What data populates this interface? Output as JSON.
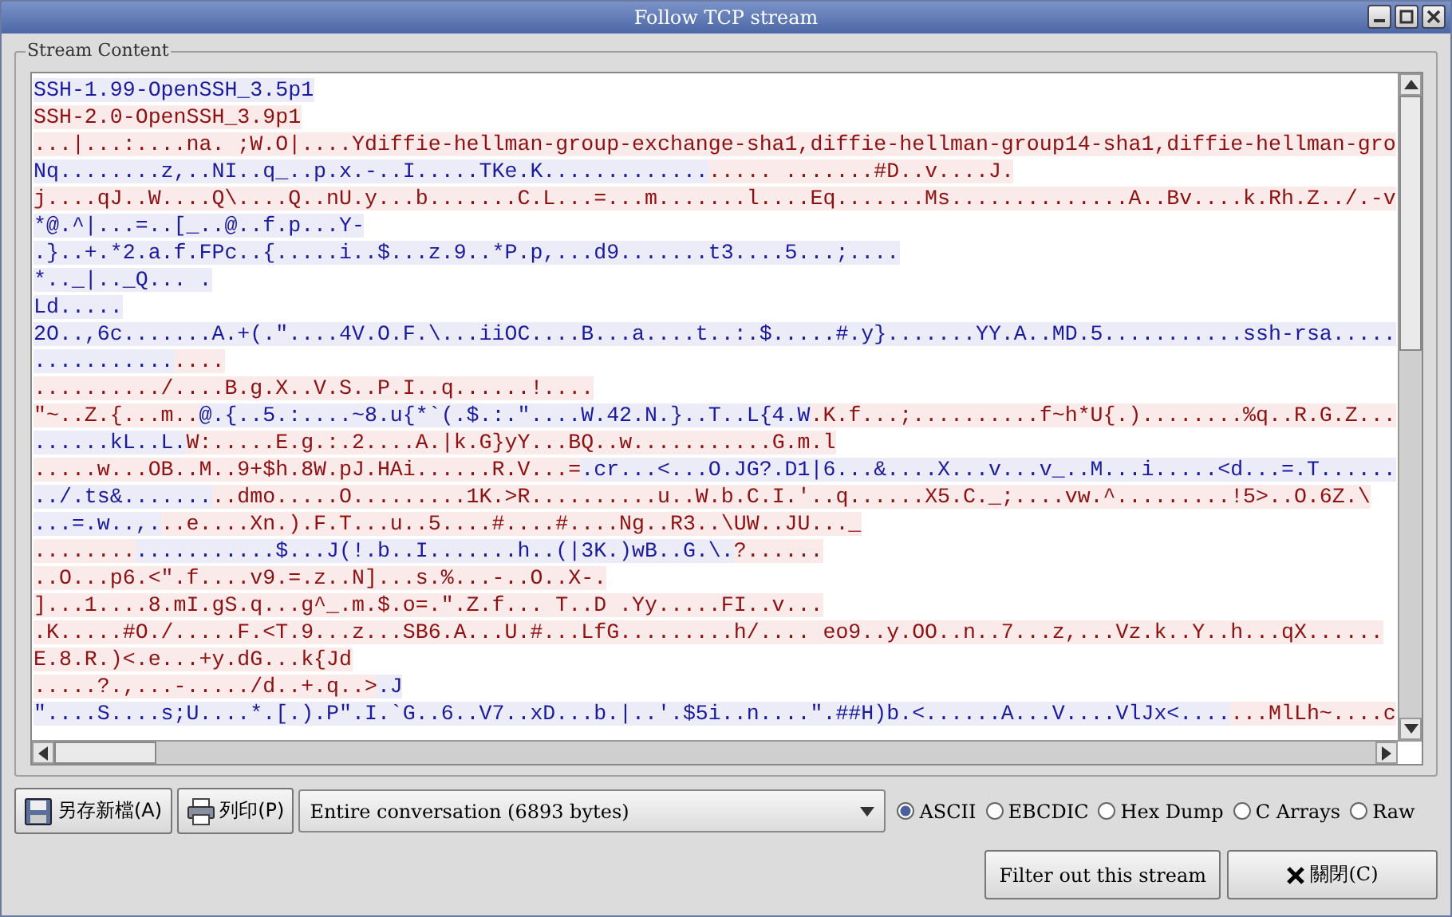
{
  "window": {
    "title": "Follow TCP stream"
  },
  "frame": {
    "label": "Stream Content"
  },
  "lines": [
    [
      {
        "kind": "client",
        "text": "SSH-1.99-OpenSSH_3.5p1"
      }
    ],
    [
      {
        "kind": "server",
        "text": "SSH-2.0-OpenSSH_3.9p1"
      }
    ],
    [
      {
        "kind": "server",
        "text": "...|...:....na. ;W.O|....Ydiffie-hellman-group-exchange-sha1,diffie-hellman-group14-sha1,diffie-hellman-gro"
      }
    ],
    [
      {
        "kind": "client",
        "text": "Nq........z,..NI..q_..p.x.-..I.....TKe.K............."
      },
      {
        "kind": "server",
        "text": "..... .......#D..v....J."
      }
    ],
    [
      {
        "kind": "server",
        "text": "j....qJ..W....Q\\....Q..nU.y...b.......C.L...=...m.......l....Eq.......Ms..............A..Bv....k.Rh.Z../.-v"
      }
    ],
    [
      {
        "kind": "client",
        "text": "*@.^|...=..[_..@..f.p...Y-"
      }
    ],
    [
      {
        "kind": "client",
        "text": ".}..+.*2.a.f.FPc..{.....i..$...z.9..*P.p,...d9.......t3....5...;...."
      }
    ],
    [
      {
        "kind": "client",
        "text": "*.._|.._Q... ."
      }
    ],
    [
      {
        "kind": "client",
        "text": "Ld....."
      }
    ],
    [
      {
        "kind": "client",
        "text": "2O..,6c.......A.+(.\"....4V.O.F.\\...iiOC....B...a....t..:.$.....#.y}.......YY.A..MD.5...........ssh-rsa....."
      }
    ],
    [
      {
        "kind": "client",
        "text": "..........."
      },
      {
        "kind": "server",
        "text": "...."
      }
    ],
    [
      {
        "kind": "server",
        "text": "........../....B.g.X..V.S..P.I..q......!...."
      }
    ],
    [
      {
        "kind": "server",
        "text": "\"~..Z.{...m.."
      },
      {
        "kind": "client",
        "text": "@.{..5.:....~8.u{*`(.$.:.\"....W.42.N.}..T..L{4.W"
      },
      {
        "kind": "server",
        "text": ".K.f...;..........f~h*U{.)........%q..R.G.Z..."
      }
    ],
    [
      {
        "kind": "client",
        "text": "......kL..L."
      },
      {
        "kind": "server",
        "text": "W:.....E.g.:.2....A.|k.G}yY...BQ..w...........G.m.l"
      }
    ],
    [
      {
        "kind": "server",
        "text": ".....w...OB..M..9+$h.8W.pJ.HAi......R.V...="
      },
      {
        "kind": "client",
        "text": ".cr...<...O.JG?.D1|6...&....X...v...v_..M...i.....<d...=.T......"
      }
    ],
    [
      {
        "kind": "client",
        "text": "../.ts&......."
      },
      {
        "kind": "server",
        "text": "..dmo.....O.........1K.>R..........u..W.b.C.I.'..q......X5.C._;....vw.^.........!5>..O.6Z.\\"
      }
    ],
    [
      {
        "kind": "client",
        "text": "...=.w..,."
      },
      {
        "kind": "server",
        "text": "..e....Xn.).F.T...u..5....#....#....Ng..R3..\\UW..JU..._"
      }
    ],
    [
      {
        "kind": "server",
        "text": "........"
      },
      {
        "kind": "client",
        "text": "...........$...J(!.b..I.......h..(|3K.)wB..G.\\."
      },
      {
        "kind": "server",
        "text": "?......"
      }
    ],
    [
      {
        "kind": "server",
        "text": "..O...p6.<\".f....v9.=.z..N]...s.%...-..O..X-."
      }
    ],
    [
      {
        "kind": "server",
        "text": "]...1....8.mI.gS.q...g^_.m.$.o=.\".Z.f... T..D .Yy.....FI..v..."
      }
    ],
    [
      {
        "kind": "server",
        "text": ".K.....#O./.....F.<T.9...z...SB6.A...U.#...LfG.........h/.... eo9..y.OO..n..7...z,...Vz.k..Y..h...qX......"
      }
    ],
    [
      {
        "kind": "server",
        "text": "E.8.R.)<.e...+y.dG...k{Jd"
      }
    ],
    [
      {
        "kind": "server",
        "text": ".....?.,...-...../d..+.q..>"
      },
      {
        "kind": "client",
        "text": ".J"
      }
    ],
    [
      {
        "kind": "client",
        "text": "\"....S....s;U....*.[.).P\".I.`G..6..V7..xD...b.|..'.$5i..n....\".##H)b.<......A...V....VlJx<...."
      },
      {
        "kind": "server",
        "text": "...MlLh~....c"
      }
    ]
  ],
  "save_button": "另存新檔(A)",
  "print_button": "列印(P)",
  "conversation": "Entire conversation (6893 bytes)",
  "encodings": [
    {
      "label": "ASCII",
      "selected": true
    },
    {
      "label": "EBCDIC",
      "selected": false
    },
    {
      "label": "Hex Dump",
      "selected": false
    },
    {
      "label": "C Arrays",
      "selected": false
    },
    {
      "label": "Raw",
      "selected": false
    }
  ],
  "filter_button": "Filter out this stream",
  "close_button": "關閉(C)"
}
